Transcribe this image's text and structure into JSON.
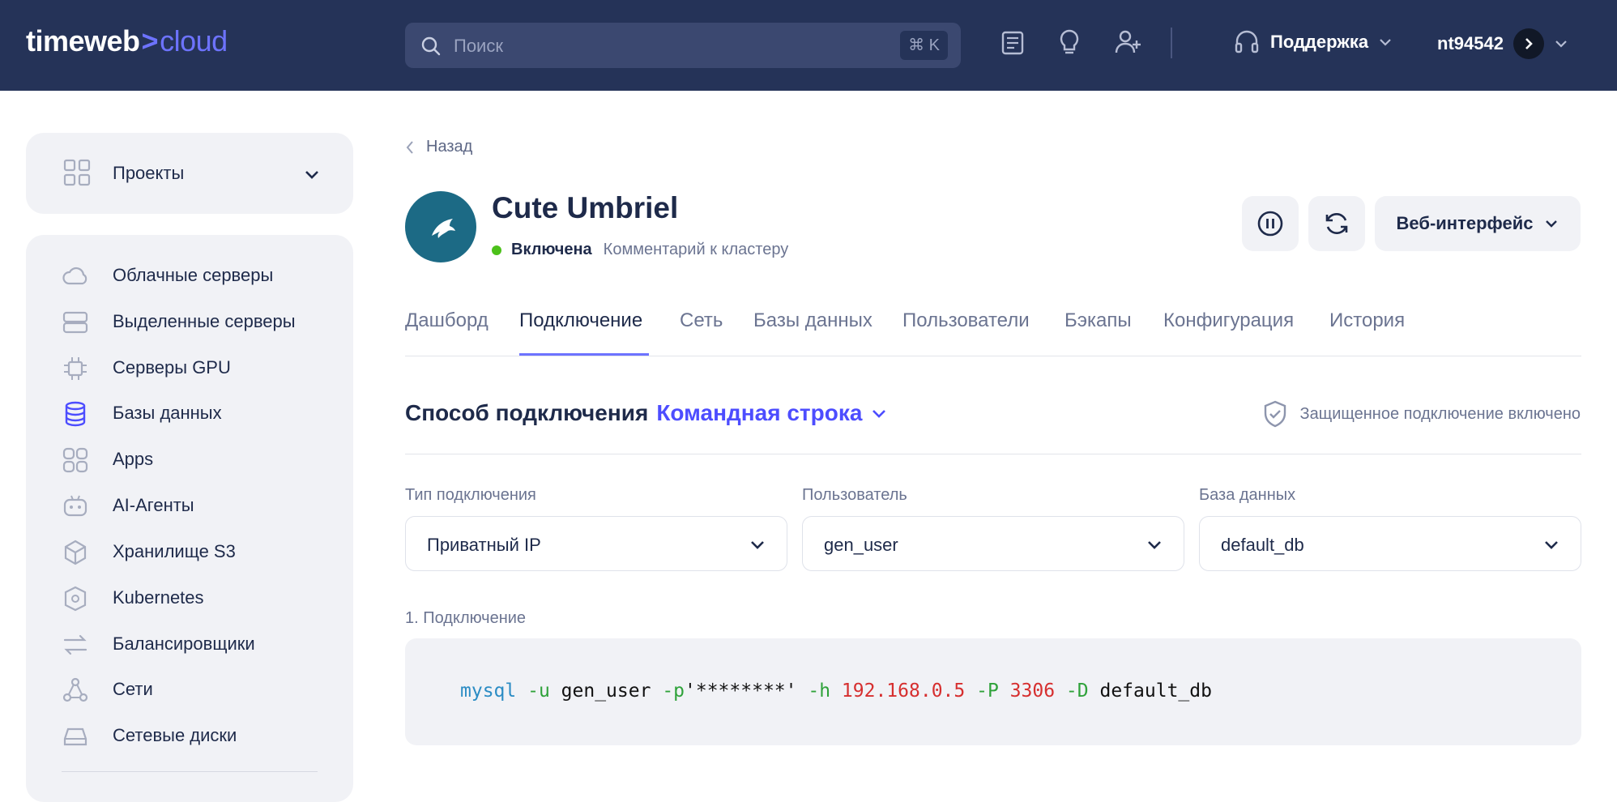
{
  "header": {
    "logo_main": "timeweb",
    "logo_arrow": ">",
    "logo_accent": "cloud",
    "search_placeholder": "Поиск",
    "search_shortcut": "⌘ K",
    "icons": [
      "news-icon",
      "lightbulb-icon",
      "add-user-icon"
    ],
    "support_label": "Поддержка",
    "account_name": "nt94542"
  },
  "sidebar": {
    "projects_label": "Проекты",
    "items": [
      {
        "label": "Облачные серверы",
        "icon": "cloud-icon"
      },
      {
        "label": "Выделенные серверы",
        "icon": "server-icon"
      },
      {
        "label": "Серверы GPU",
        "icon": "chip-icon"
      },
      {
        "label": "Базы данных",
        "icon": "database-icon",
        "active": true
      },
      {
        "label": "Apps",
        "icon": "apps-icon"
      },
      {
        "label": "AI-Агенты",
        "icon": "robot-icon"
      },
      {
        "label": "Хранилище S3",
        "icon": "cube-icon"
      },
      {
        "label": "Kubernetes",
        "icon": "kubernetes-icon"
      },
      {
        "label": "Балансировщики",
        "icon": "balancer-icon"
      },
      {
        "label": "Сети",
        "icon": "network-icon"
      },
      {
        "label": "Сетевые диски",
        "icon": "disk-icon"
      }
    ]
  },
  "main": {
    "back_label": "Назад",
    "cluster_name": "Cute Umbriel",
    "status_label": "Включена",
    "comment_label": "Комментарий к кластеру",
    "web_button_label": "Веб-интерфейс",
    "tabs": [
      {
        "label": "Дашборд"
      },
      {
        "label": "Подключение",
        "active": true
      },
      {
        "label": "Сеть"
      },
      {
        "label": "Базы данных"
      },
      {
        "label": "Пользователи"
      },
      {
        "label": "Бэкапы"
      },
      {
        "label": "Конфигурация"
      },
      {
        "label": "История"
      }
    ],
    "connection": {
      "method_label": "Способ подключения",
      "method_value": "Командная строка",
      "secure_label": "Защищенное подключение включено",
      "type_label": "Тип подключения",
      "type_value": "Приватный IP",
      "user_label": "Пользователь",
      "user_value": "gen_user",
      "db_label": "База данных",
      "db_value": "default_db",
      "step_label": "1. Подключение",
      "command": {
        "cmd": "mysql",
        "u_flag": "-u",
        "user": "gen_user",
        "p_flag": "-p",
        "password": "'********'",
        "h_flag": "-h",
        "host": "192.168.0.5",
        "P_flag": "-P",
        "port": "3306",
        "D_flag": "-D",
        "database": "default_db"
      }
    }
  },
  "colors": {
    "header_bg": "#253358",
    "accent": "#6d73ff",
    "link_accent": "#4d4dff",
    "status_green": "#4cc11a",
    "avatar_bg": "#1c6a85",
    "panel_bg": "#f1f2f6"
  }
}
